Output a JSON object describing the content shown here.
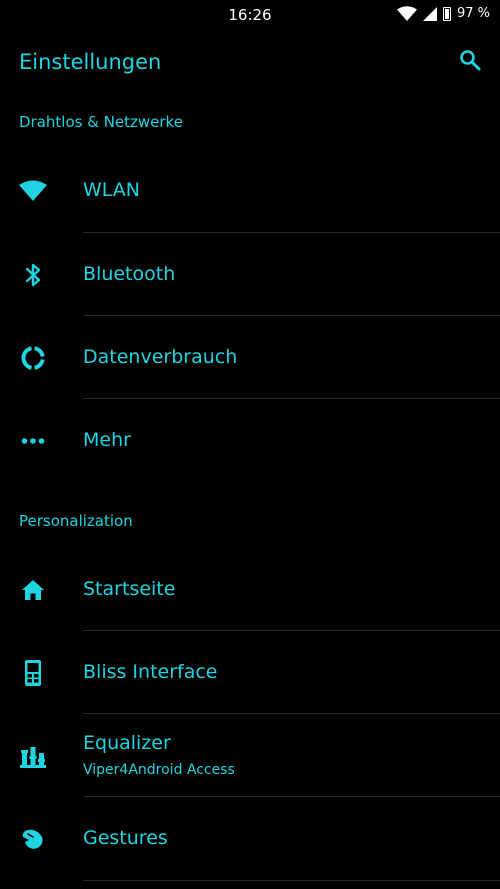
{
  "status_bar": {
    "time": "16:26",
    "battery": "97 %",
    "icons": [
      "wifi-icon",
      "cell-signal-icon",
      "battery-icon"
    ]
  },
  "app_bar": {
    "title": "Einstellungen",
    "search_icon": "search-icon"
  },
  "sections": [
    {
      "header": "Drahtlos & Netzwerke",
      "items": [
        {
          "label": "WLAN",
          "icon": "wifi-icon"
        },
        {
          "label": "Bluetooth",
          "icon": "bluetooth-icon"
        },
        {
          "label": "Datenverbrauch",
          "icon": "data-usage-icon"
        },
        {
          "label": "Mehr",
          "icon": "more-dots-icon"
        }
      ]
    },
    {
      "header": "Personalization",
      "items": [
        {
          "label": "Startseite",
          "icon": "home-icon"
        },
        {
          "label": "Bliss Interface",
          "icon": "phone-interface-icon"
        },
        {
          "label": "Equalizer",
          "subtitle": "Viper4Android Access",
          "icon": "equalizer-icon"
        },
        {
          "label": "Gestures",
          "icon": "gesture-hand-icon"
        }
      ]
    }
  ],
  "colors": {
    "accent": "#1fd4e0",
    "background": "#000000",
    "divider": "#2a2a2a",
    "status_text": "#ffffff"
  }
}
